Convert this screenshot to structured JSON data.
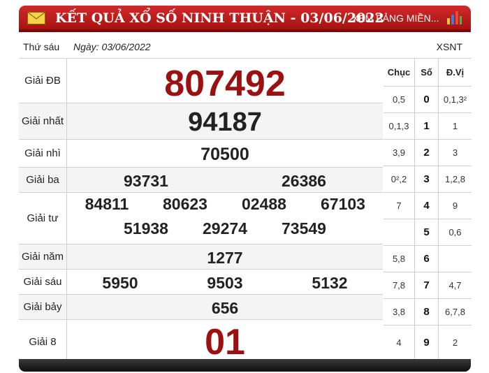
{
  "header": {
    "title": "KẾT QUẢ XỔ SỐ NINH THUẬN - 03/06/2022",
    "link": "XEM BẢNG MIỀN..."
  },
  "subheader": {
    "day": "Thứ sáu",
    "date": "Ngày: 03/06/2022",
    "code": "XSNT"
  },
  "prizes": [
    {
      "label": "Giải ĐB",
      "numbers": [
        "807492"
      ]
    },
    {
      "label": "Giải nhất",
      "numbers": [
        "94187"
      ]
    },
    {
      "label": "Giải nhì",
      "numbers": [
        "70500"
      ]
    },
    {
      "label": "Giải ba",
      "numbers": [
        "93731",
        "26386"
      ]
    },
    {
      "label": "Giải tư",
      "numbers": [
        "84811",
        "80623",
        "02488",
        "67103",
        "51938",
        "29274",
        "73549"
      ]
    },
    {
      "label": "Giải năm",
      "numbers": [
        "1277"
      ]
    },
    {
      "label": "Giải sáu",
      "numbers": [
        "5950",
        "9503",
        "5132"
      ]
    },
    {
      "label": "Giải bảy",
      "numbers": [
        "656"
      ]
    },
    {
      "label": "Giải 8",
      "numbers": [
        "01"
      ]
    }
  ],
  "loto": {
    "headers": [
      "Chục",
      "Số",
      "Đ.Vị"
    ],
    "rows": [
      {
        "chuc": "0,5",
        "so": "0",
        "dvi": "0,1,3²"
      },
      {
        "chuc": "0,1,3",
        "so": "1",
        "dvi": "1"
      },
      {
        "chuc": "3,9",
        "so": "2",
        "dvi": "3"
      },
      {
        "chuc": "0²,2",
        "so": "3",
        "dvi": "1,2,8"
      },
      {
        "chuc": "7",
        "so": "4",
        "dvi": "9"
      },
      {
        "chuc": "",
        "so": "5",
        "dvi": "0,6"
      },
      {
        "chuc": "5,8",
        "so": "6",
        "dvi": ""
      },
      {
        "chuc": "7,8",
        "so": "7",
        "dvi": "4,7"
      },
      {
        "chuc": "3,8",
        "so": "8",
        "dvi": "6,7,8"
      },
      {
        "chuc": "4",
        "so": "9",
        "dvi": "2"
      }
    ]
  },
  "colors": {
    "header_red": "#c41e1e",
    "special_prize": "#9b1111",
    "number_text": "#222222"
  }
}
